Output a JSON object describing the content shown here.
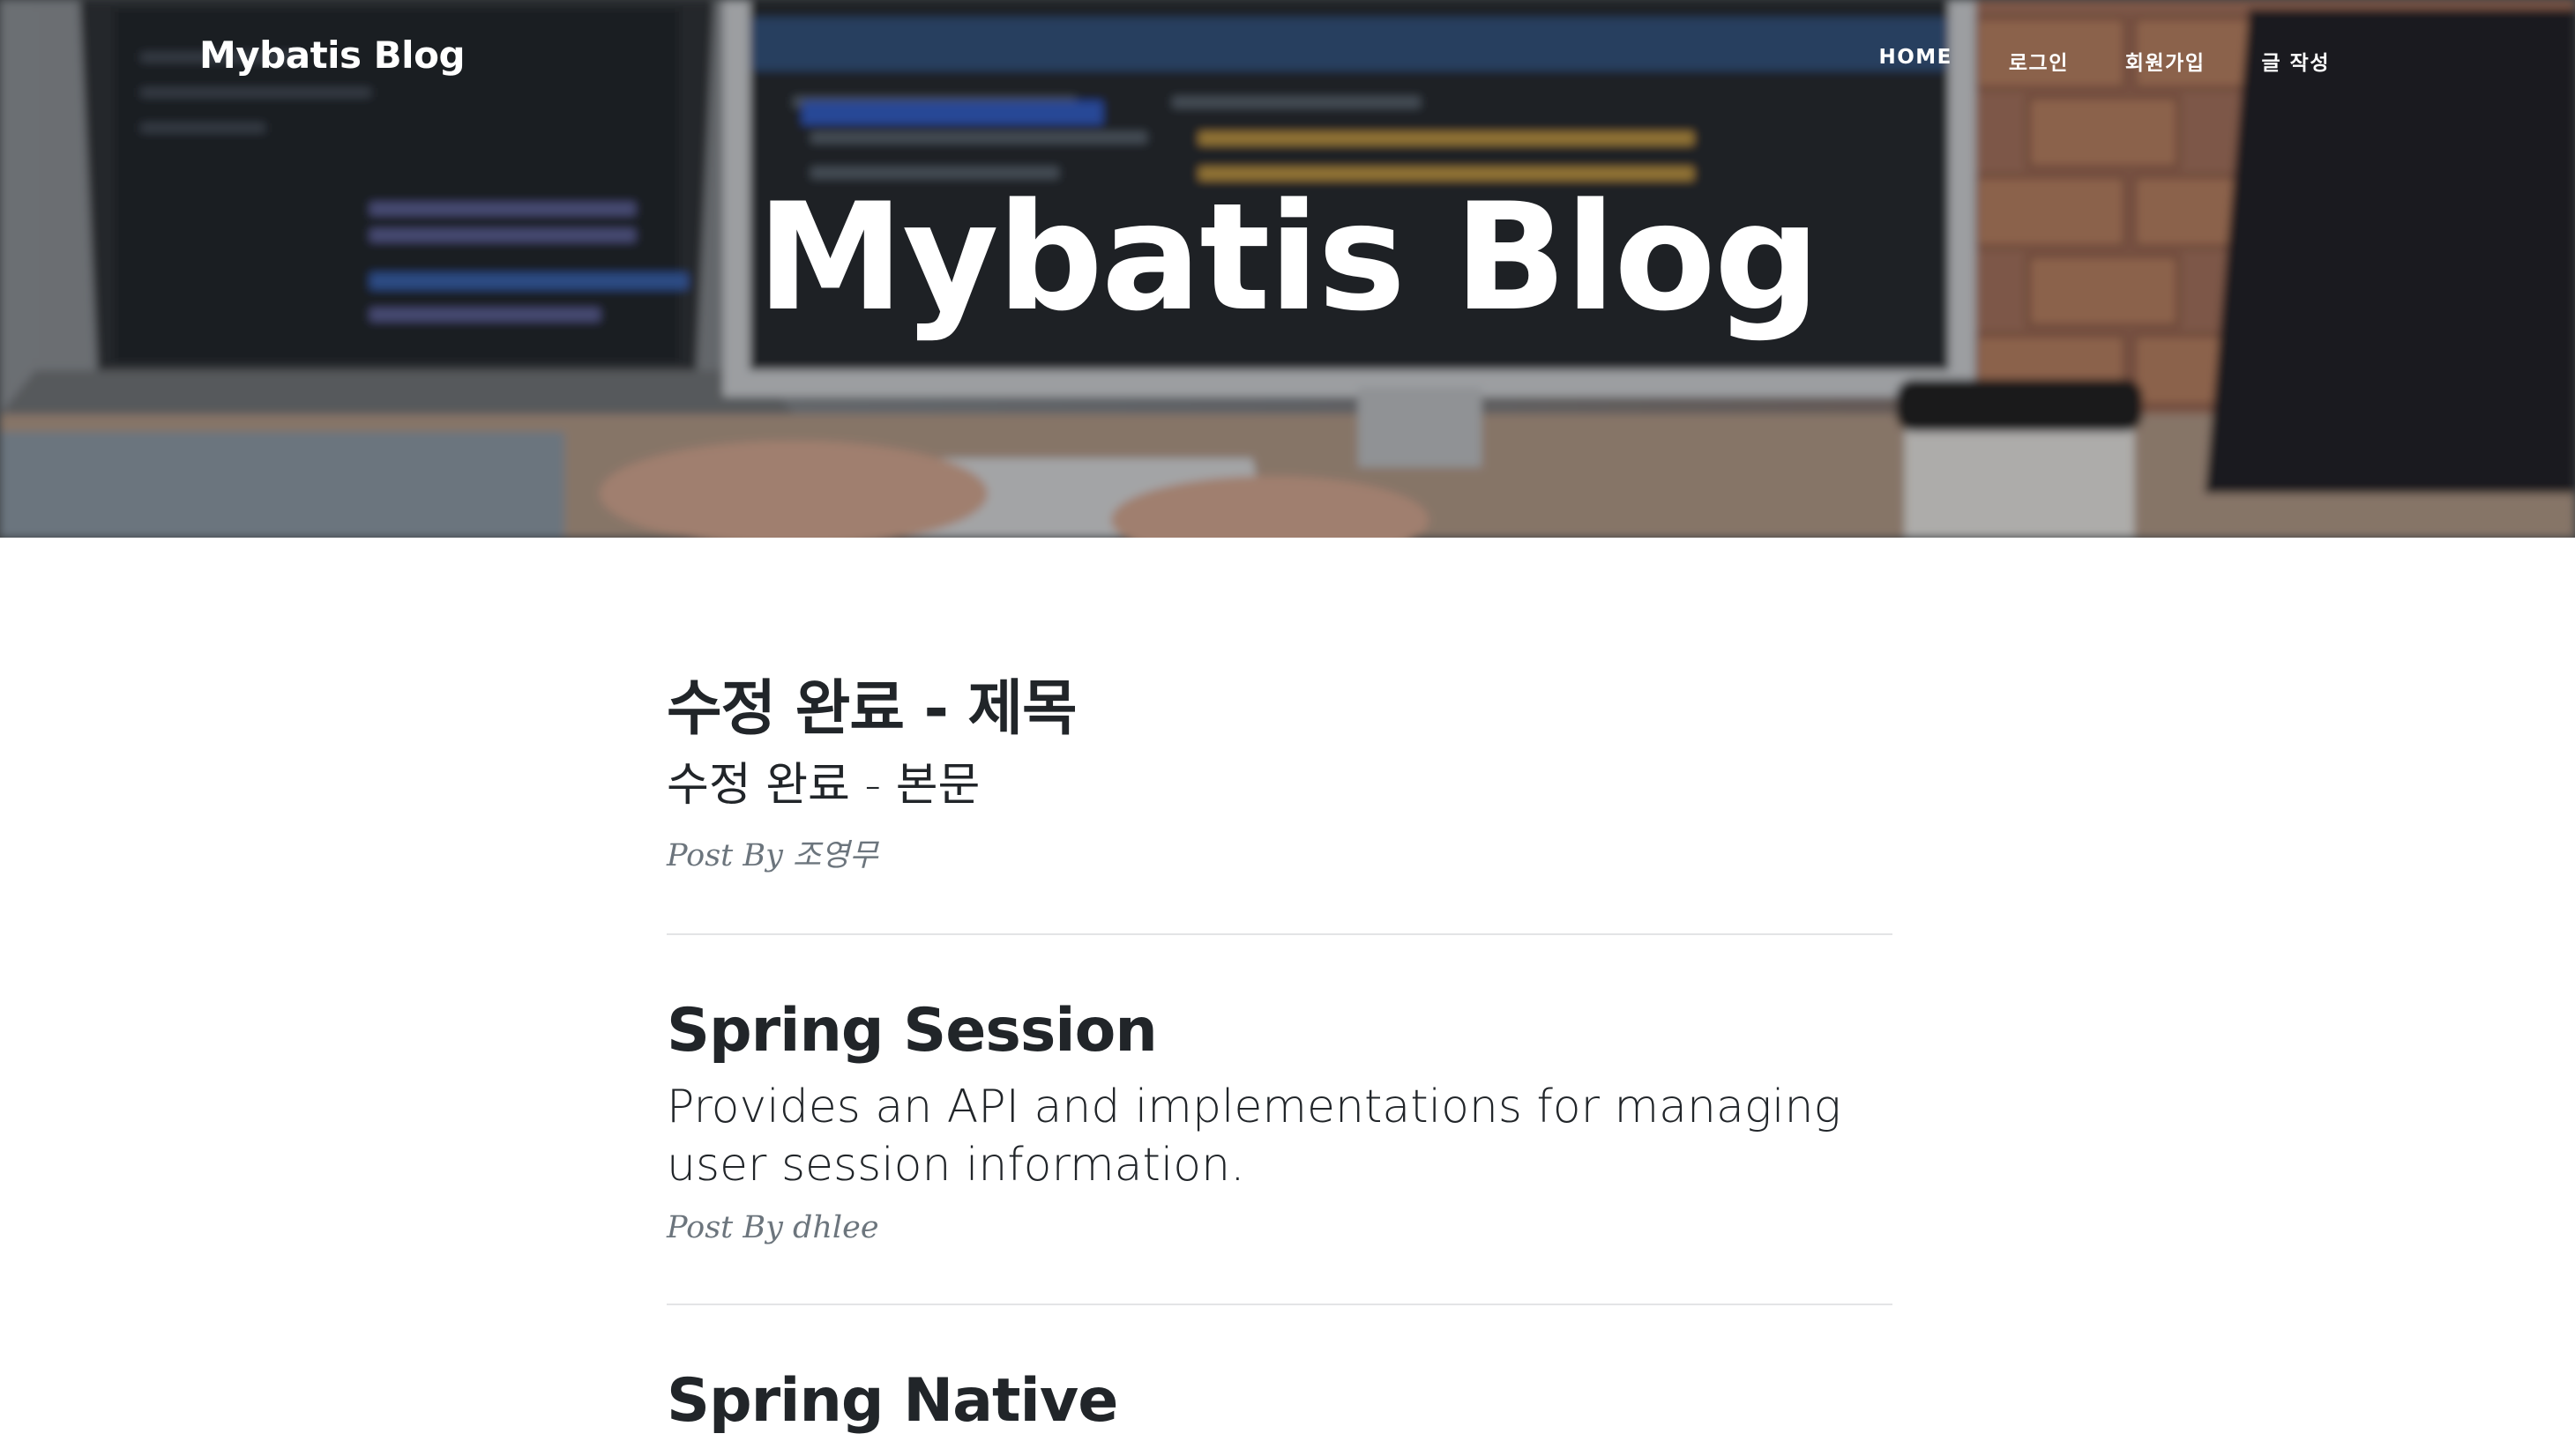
{
  "nav": {
    "brand": "Mybatis Blog",
    "links": [
      "HOME",
      "로그인",
      "회원가입",
      "글 작성"
    ]
  },
  "hero": {
    "title": "Mybatis Blog"
  },
  "posts": [
    {
      "title": "수정 완료 - 제목",
      "subtitle": "수정 완료 - 본문",
      "meta_prefix": "Post By ",
      "author": "조영무"
    },
    {
      "title": "Spring Session",
      "subtitle": "Provides an API and implementations for managing user session information.",
      "meta_prefix": "Post By ",
      "author": "dhlee"
    },
    {
      "title": "Spring Native",
      "subtitle": "",
      "meta_prefix": "",
      "author": ""
    }
  ],
  "colors": {
    "text": "#212529",
    "meta": "#6c757d",
    "divider": "#e3e4e6"
  }
}
